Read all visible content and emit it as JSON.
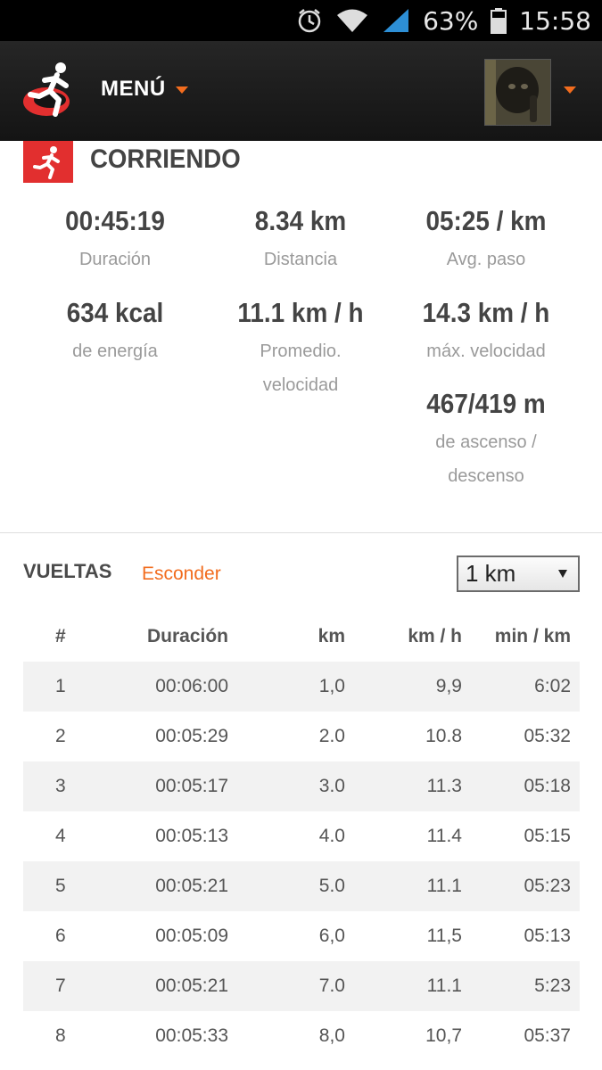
{
  "status_bar": {
    "icons": [
      "alarm-icon",
      "wifi-icon",
      "signal-icon",
      "battery-icon"
    ],
    "battery": "63%",
    "time": "15:58"
  },
  "header": {
    "menu_label": "MENÚ",
    "accent_color": "#f26c1e"
  },
  "activity": {
    "title": "CORRIENDO",
    "icon": "runner-icon",
    "icon_color": "#e22f2f"
  },
  "stats": [
    {
      "value": "00:45:19",
      "label": "Duración"
    },
    {
      "value": "8.34  km",
      "label": "Distancia"
    },
    {
      "value": "05:25  / km",
      "label": "Avg. paso"
    },
    {
      "value": "634  kcal",
      "label": "de energía"
    },
    {
      "value": "11.1  km / h",
      "label": "Promedio. velocidad"
    },
    {
      "value": "14.3  km / h",
      "label": "máx. velocidad"
    },
    {
      "value": "467/419  m",
      "label": "de ascenso / descenso"
    }
  ],
  "laps": {
    "title": "VUELTAS",
    "hide_label": "Esconder",
    "select_value": "1 km",
    "columns": [
      "#",
      "Duración",
      "km",
      "km / h",
      "min / km"
    ],
    "rows": [
      [
        "1",
        "00:06:00",
        "1,0",
        "9,9",
        "6:02"
      ],
      [
        "2",
        "00:05:29",
        "2.0",
        "10.8",
        "05:32"
      ],
      [
        "3",
        "00:05:17",
        "3.0",
        "11.3",
        "05:18"
      ],
      [
        "4",
        "00:05:13",
        "4.0",
        "11.4",
        "05:15"
      ],
      [
        "5",
        "00:05:21",
        "5.0",
        "11.1",
        "05:23"
      ],
      [
        "6",
        "00:05:09",
        "6,0",
        "11,5",
        "05:13"
      ],
      [
        "7",
        "00:05:21",
        "7.0",
        "11.1",
        "5:23"
      ],
      [
        "8",
        "00:05:33",
        "8,0",
        "10,7",
        "05:37"
      ]
    ]
  }
}
